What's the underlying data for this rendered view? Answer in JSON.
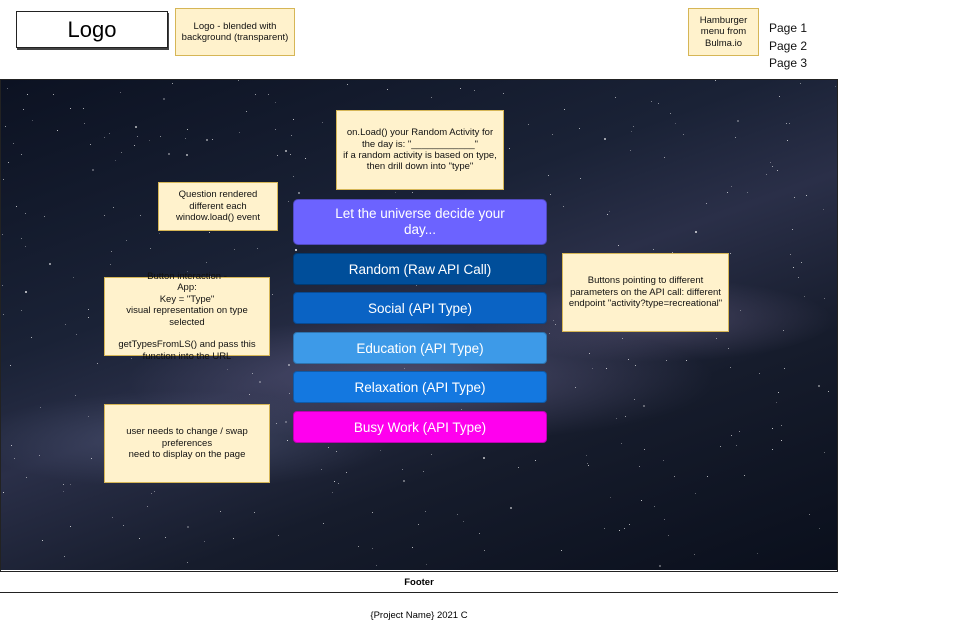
{
  "header": {
    "logo": "Logo",
    "logo_note": "Logo - blended with background (transparent)",
    "hamburger_note": "Hamburger menu from Bulma.io",
    "nav": [
      "Page 1",
      "Page 2",
      "Page 3"
    ]
  },
  "hero": {
    "onload_note": "on.Load() your Random Activity for the day is: \"____________\"\nif a random activity is based on type, then drill down into \"type\"",
    "question_note": "Question rendered different each window.load() event",
    "button_note": "Button interaction -\nApp:\nKey = \"Type\"\nvisual representation on type selected\n\ngetTypesFromLS() and pass this function into the URL",
    "api_note": "Buttons pointing to different parameters on the API call: different endpoint \"activity?type=recreational\"",
    "prefs_note": "user needs to change / swap preferences\nneed to display on the page",
    "main_button": "Let the universe decide your day...",
    "buttons": [
      {
        "label": "Random (Raw API Call)",
        "color": "#004e9a"
      },
      {
        "label": "Social (API Type)",
        "color": "#0a63c4"
      },
      {
        "label": "Education (API Type)",
        "color": "#3d9ae8"
      },
      {
        "label": "Relaxation (API Type)",
        "color": "#1478e0"
      },
      {
        "label": "Busy Work (API Type)",
        "color": "#ff00ee"
      }
    ]
  },
  "footer": {
    "title": "Footer",
    "text": "{Project Name} 2021 C"
  }
}
